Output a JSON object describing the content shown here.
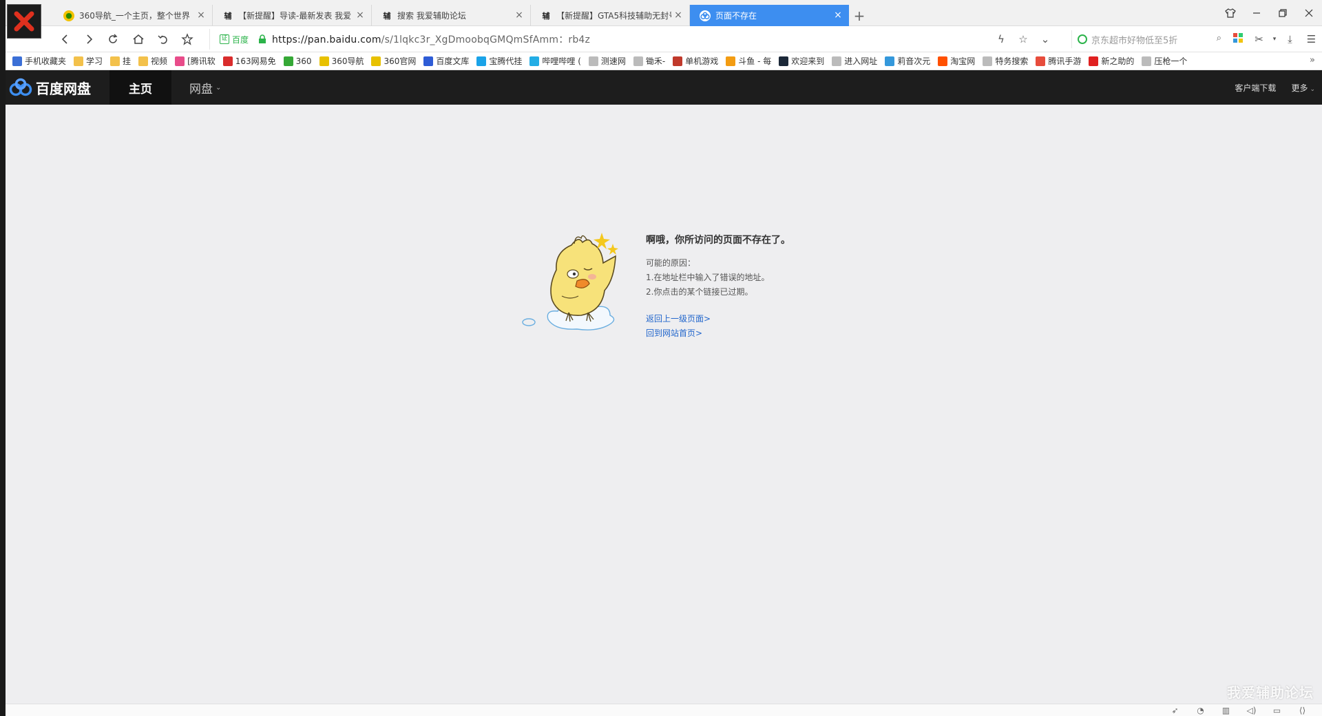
{
  "browser": {
    "tabs": [
      {
        "favicon": "360-nav-icon",
        "title": "360导航_一个主页，整个世界",
        "active": false
      },
      {
        "favicon": "fu-icon",
        "title": "【新提醒】导读-最新发表 我爱",
        "active": false
      },
      {
        "favicon": "fu-icon",
        "title": "搜索 我爱辅助论坛",
        "active": false
      },
      {
        "favicon": "fu-icon",
        "title": "【新提醒】GTA5科技辅助无封号",
        "active": false
      },
      {
        "favicon": "baidu-pan-icon",
        "title": "页面不存在",
        "active": true
      }
    ],
    "fav_glyph": "辅",
    "close_glyph": "×",
    "new_tab_glyph": "+",
    "address": {
      "cert_label": "百度",
      "cert_glyph": "证",
      "url_host": "https://pan.baidu.com",
      "url_path": "/s/1lqkc3r_XgDmoobqGMQmSfAmm：rb4z"
    },
    "search": {
      "placeholder": "京东超市好物低至5折"
    },
    "bookmarks": [
      {
        "label": "手机收藏夹",
        "color": "#3b6fd6"
      },
      {
        "label": "学习",
        "color": "#f3c14b"
      },
      {
        "label": "挂",
        "color": "#f3c14b"
      },
      {
        "label": "视频",
        "color": "#f3c14b"
      },
      {
        "label": "[腾讯软",
        "color": "#e84c8a"
      },
      {
        "label": "163网易免",
        "color": "#d92c2c"
      },
      {
        "label": "360",
        "color": "#35a836"
      },
      {
        "label": "360导航",
        "color": "#e8c100"
      },
      {
        "label": "360官网",
        "color": "#e8c100"
      },
      {
        "label": "百度文库",
        "color": "#2e5cd6"
      },
      {
        "label": "宝腾代挂",
        "color": "#1aa3e8"
      },
      {
        "label": "哔哩哔哩 (",
        "color": "#23ade5"
      },
      {
        "label": "测速网",
        "color": "#bbbbbb"
      },
      {
        "label": "锄禾-",
        "color": "#bbbbbb"
      },
      {
        "label": "单机游戏",
        "color": "#c0392b"
      },
      {
        "label": "斗鱼 - 每",
        "color": "#f39c12"
      },
      {
        "label": "欢迎来到",
        "color": "#1b2838"
      },
      {
        "label": "进入网址",
        "color": "#bbbbbb"
      },
      {
        "label": "莉音次元",
        "color": "#3498db"
      },
      {
        "label": "淘宝网",
        "color": "#ff5000"
      },
      {
        "label": "特务搜索",
        "color": "#bbbbbb"
      },
      {
        "label": "腾讯手游",
        "color": "#e74c3c"
      },
      {
        "label": "新之助的",
        "color": "#e02020"
      },
      {
        "label": "压枪一个",
        "color": "#bbbbbb"
      }
    ],
    "bookmarks_more": "»"
  },
  "pan": {
    "logo_text": "百度网盘",
    "nav": [
      {
        "label": "主页",
        "active": true
      },
      {
        "label": "网盘",
        "active": false,
        "caret": "⌄"
      }
    ],
    "right": [
      {
        "label": "客户端下载"
      },
      {
        "label": "更多",
        "caret": "⌄"
      }
    ]
  },
  "error": {
    "title": "啊哦，你所访问的页面不存在了。",
    "reasons_heading": "可能的原因：",
    "reasons": [
      "1.在地址栏中输入了错误的地址。",
      "2.你点击的某个链接已过期。"
    ],
    "links": [
      "返回上一级页面>",
      "回到网站首页>"
    ]
  },
  "watermark": "我爱辅助论坛",
  "colors": {
    "tab_active": "#3d8ef0",
    "header_bg": "#1d1d1d",
    "content_bg": "#eeeef0",
    "link": "#2266cc",
    "cert_green": "#2bb34a"
  }
}
